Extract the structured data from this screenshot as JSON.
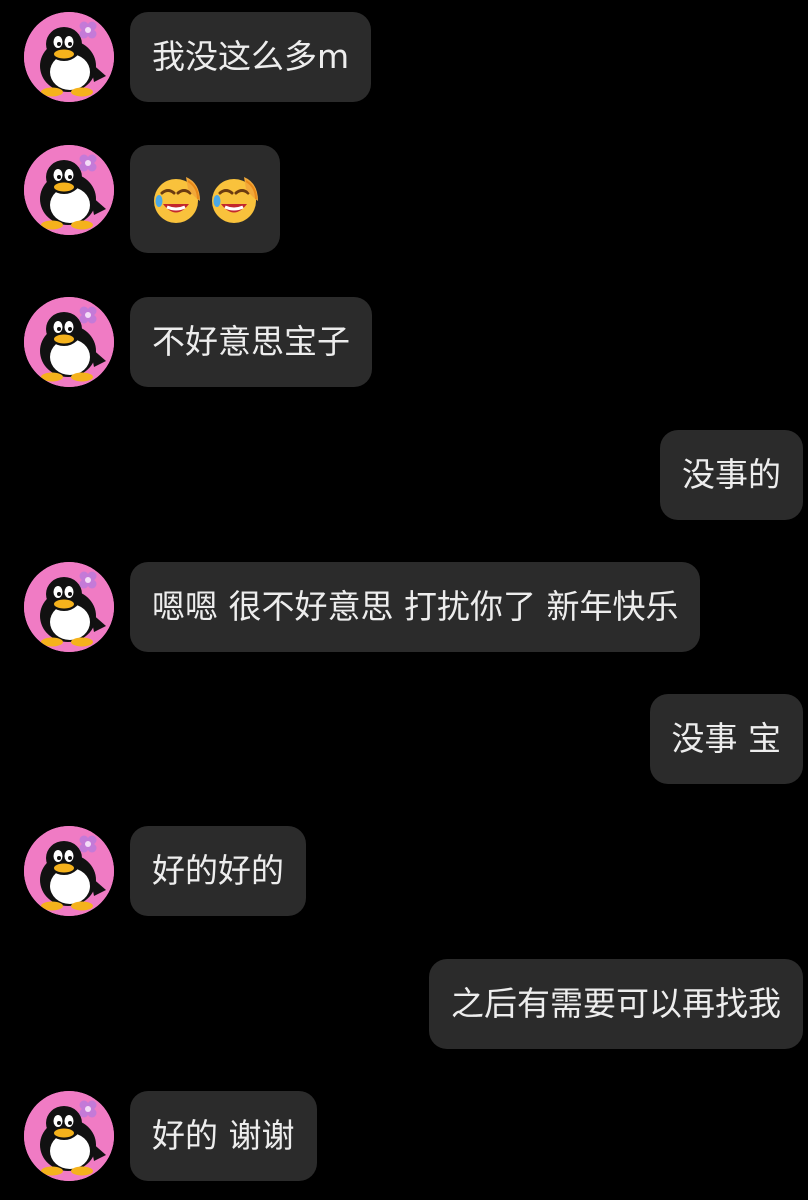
{
  "colors": {
    "background": "#000000",
    "bubble": "#2b2b2b",
    "text": "#ededed",
    "avatar_ring": "#f07bc4"
  },
  "messages": [
    {
      "side": "in",
      "text": "我没这么多m"
    },
    {
      "side": "in",
      "type": "emoji",
      "emoji": [
        "laughing-tears-emoji",
        "laughing-tears-emoji"
      ]
    },
    {
      "side": "in",
      "text": "不好意思宝子"
    },
    {
      "side": "out",
      "text": "没事的"
    },
    {
      "side": "in",
      "text": "嗯嗯 很不好意思 打扰你了 新年快乐"
    },
    {
      "side": "out",
      "text": "没事 宝"
    },
    {
      "side": "in",
      "text": "好的好的"
    },
    {
      "side": "out",
      "text": "之后有需要可以再找我"
    },
    {
      "side": "in",
      "text": "好的 谢谢"
    }
  ]
}
